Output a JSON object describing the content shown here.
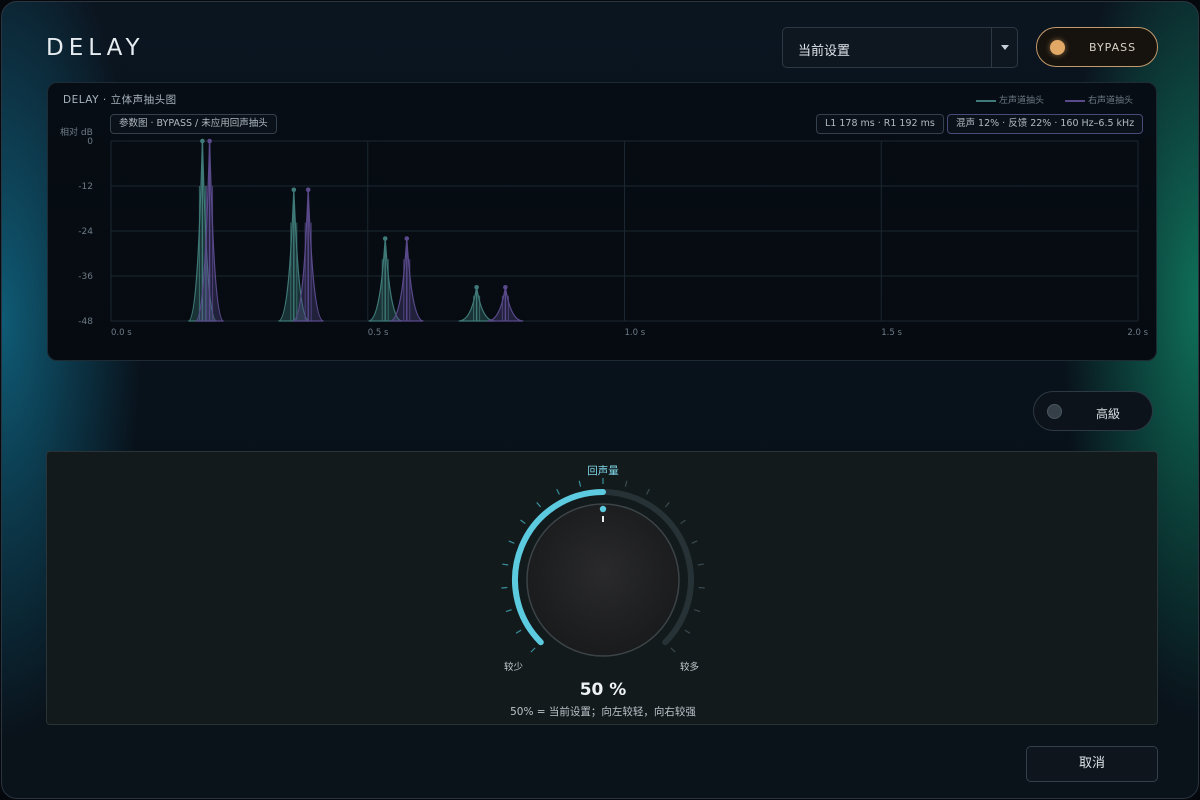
{
  "header": {
    "title": "DELAY",
    "preset_value": "当前设置",
    "bypass_label": "BYPASS"
  },
  "graph": {
    "title": "DELAY · 立体声抽头图",
    "legend_left": "左声道抽头",
    "legend_right": "右声道抽头",
    "chip_params": "参数图 · BYPASS / 未应用回声抽头",
    "chip_taps": "L1 178 ms · R1 192 ms",
    "chip_settings": "混声 12% · 反馈 22% · 160 Hz–6.5 kHz",
    "ylabel": "相对 dB",
    "colors": {
      "left": "#3f7a78",
      "right": "#5a4a8c",
      "grid": "#1c2630"
    }
  },
  "chart_data": {
    "type": "line",
    "title": "DELAY · 立体声抽头图",
    "ylabel": "相对 dB",
    "xlabel": "",
    "xlim": [
      0,
      2.0
    ],
    "ylim": [
      -48,
      0
    ],
    "x_ticks": [
      "0.0 s",
      "0.5 s",
      "1.0 s",
      "1.5 s",
      "2.0 s"
    ],
    "x_tick_values": [
      0,
      0.5,
      1.0,
      1.5,
      2.0
    ],
    "y_ticks": [
      "0",
      "-12",
      "-24",
      "-36",
      "-48"
    ],
    "y_tick_values": [
      0,
      -12,
      -24,
      -36,
      -48
    ],
    "series": [
      {
        "name": "左声道抽头",
        "color": "#3f7a78",
        "taps": [
          {
            "t": 0.178,
            "db": 0
          },
          {
            "t": 0.356,
            "db": -13
          },
          {
            "t": 0.534,
            "db": -26
          },
          {
            "t": 0.712,
            "db": -39
          }
        ]
      },
      {
        "name": "右声道抽头",
        "color": "#5a4a8c",
        "taps": [
          {
            "t": 0.192,
            "db": 0
          },
          {
            "t": 0.384,
            "db": -13
          },
          {
            "t": 0.576,
            "db": -26
          },
          {
            "t": 0.768,
            "db": -39
          }
        ]
      }
    ]
  },
  "advanced": {
    "label": "高級"
  },
  "knob": {
    "title": "回声量",
    "min_label": "较少",
    "max_label": "较多",
    "value": 50,
    "value_label": "50 %",
    "hint": "50% = 当前设置；向左较轻，向右较强",
    "accent": "#5ccbe0"
  },
  "footer": {
    "cancel_label": "取消"
  }
}
